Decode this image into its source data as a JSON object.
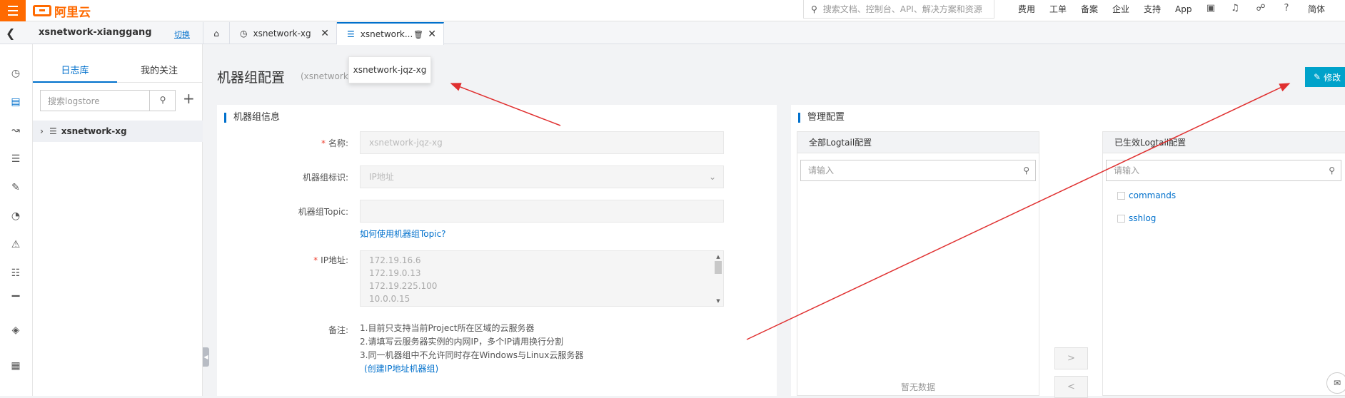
{
  "topbar": {
    "logo": "阿里云",
    "search_placeholder": "搜索文档、控制台、API、解决方案和资源",
    "nav": [
      "费用",
      "工单",
      "备案",
      "企业",
      "支持",
      "App"
    ],
    "lang": "简体"
  },
  "project": {
    "name": "xsnetwork-xianggang",
    "switch_label": "切换"
  },
  "tabs": [
    {
      "label": "xsnetwork-xg"
    },
    {
      "label": "xsnetwork..."
    }
  ],
  "tooltip": "xsnetwork-jqz-xg",
  "logpanel": {
    "tab_logstore": "日志库",
    "tab_follow": "我的关注",
    "search_placeholder": "搜索logstore",
    "item": "xsnetwork-xg"
  },
  "main": {
    "title": "机器组配置",
    "subtitle": "(xsnetwork-j",
    "edit_label": "修改"
  },
  "info": {
    "title": "机器组信息",
    "name_label": "名称:",
    "name_value": "xsnetwork-jqz-xg",
    "id_label": "机器组标识:",
    "id_value": "IP地址",
    "topic_label": "机器组Topic:",
    "topic_value": "",
    "topic_help": "如何使用机器组Topic?",
    "ip_label": "IP地址:",
    "ips": [
      "172.19.16.6",
      "172.19.0.13",
      "172.19.225.100",
      "10.0.0.15"
    ],
    "note_label": "备注:",
    "notes": [
      "1.目前只支持当前Project所在区域的云服务器",
      "2.请填写云服务器实例的内网IP，多个IP请用换行分割",
      "3.同一机器组中不允许同时存在Windows与Linux云服务器"
    ],
    "note_link": "(创建IP地址机器组)"
  },
  "manage": {
    "title": "管理配置",
    "all_title": "全部Logtail配置",
    "applied_title": "已生效Logtail配置",
    "search_placeholder": "请输入",
    "empty": "暂无数据",
    "applied_items": [
      "commands",
      "sshlog"
    ],
    "move_right": ">",
    "move_left": "<"
  },
  "colors": {
    "brand": "#ff6a00",
    "accent": "#0070cc",
    "edit_button": "#00a2ca",
    "annotation": "#e03030"
  }
}
